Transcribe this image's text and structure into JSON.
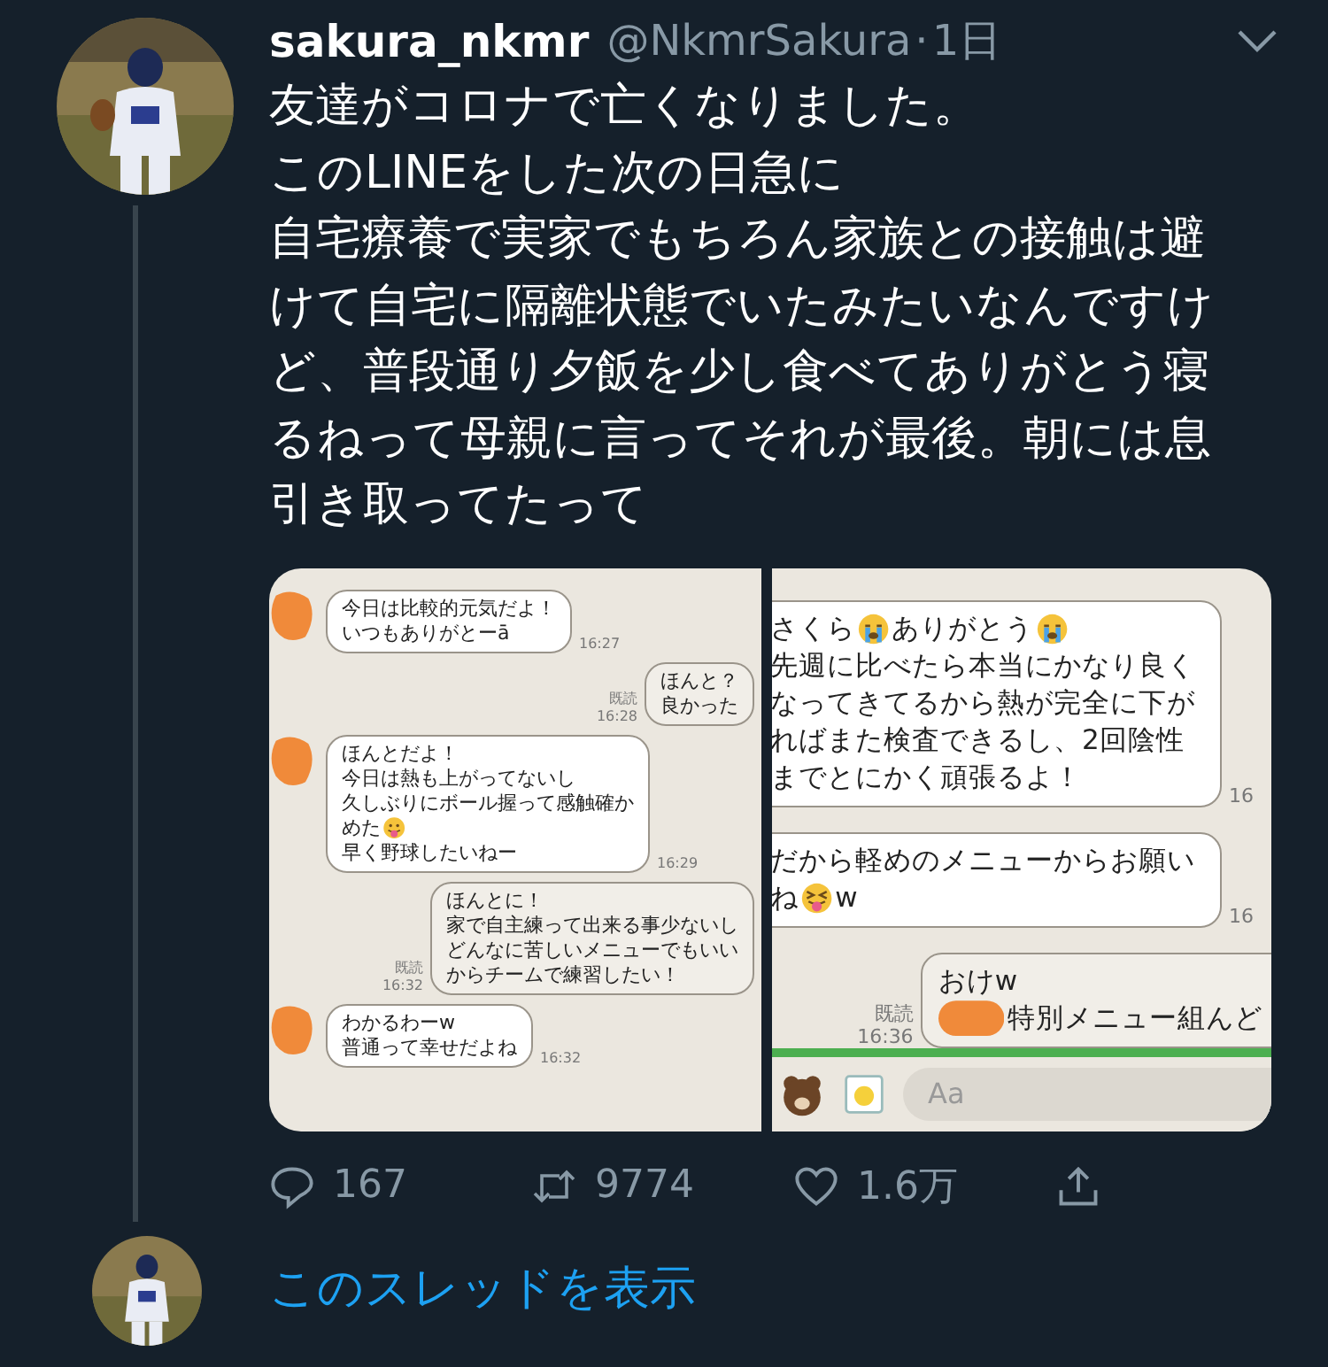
{
  "tweet": {
    "display_name": "sakura_nkmr",
    "handle": "@NkmrSakura",
    "separator": "·",
    "time": "1日",
    "paragraphs": [
      "友達がコロナで亡くなりました。",
      "このLINEをした次の日急に",
      "自宅療養で実家でもちろん家族との接触は避けて自宅に隔離状態でいたみたいなんですけど、普段通り夕飯を少し食べてありがとう寝るねって母親に言ってそれが最後。朝には息引き取ってたって"
    ]
  },
  "images": [
    {
      "messages": [
        {
          "kind": "received",
          "avatar_redacted": true,
          "lines": [
            "今日は比較的元気だよ！",
            "いつもありがとーā"
          ],
          "time": "16:27"
        },
        {
          "kind": "sent",
          "read": "既読",
          "lines": [
            "ほんと？",
            "良かった"
          ],
          "time": "16:28"
        },
        {
          "kind": "received",
          "avatar_redacted": true,
          "lines": [
            "ほんとだよ！",
            "今日は熱も上がってないし",
            "久しぶりにボール握って感触確か",
            [
              {
                "kind": "text",
                "text": "めた"
              },
              {
                "kind": "tongue-emoji"
              }
            ],
            "早く野球したいねー"
          ],
          "time": "16:29"
        },
        {
          "kind": "sent",
          "read": "既読",
          "lines": [
            "ほんとに！",
            "家で自主練って出来る事少ないし",
            "どんなに苦しいメニューでもいい",
            "からチームで練習したい！"
          ],
          "time": "16:32"
        },
        {
          "kind": "received",
          "avatar_redacted": true,
          "lines": [
            "わかるわーw",
            "普通って幸せだよね"
          ],
          "time": "16:32"
        }
      ]
    },
    {
      "messages": [
        {
          "kind": "received",
          "avatar_redacted": false,
          "lines": [
            [
              {
                "kind": "text",
                "text": "さくら"
              },
              {
                "kind": "cry-emoji"
              },
              {
                "kind": "text",
                "text": "ありがとう"
              },
              {
                "kind": "cry-emoji"
              }
            ],
            "先週に比べたら本当にかなり良く",
            "なってきてるから熱が完全に下が",
            "ればまた検査できるし、2回陰性",
            "までとにかく頑張るよ！"
          ],
          "time": "16"
        },
        {
          "kind": "received",
          "avatar_redacted": false,
          "lines": [
            "だから軽めのメニューからお願い",
            [
              {
                "kind": "text",
                "text": "ね"
              },
              {
                "kind": "squint-emoji"
              },
              {
                "kind": "text",
                "text": "w"
              }
            ]
          ],
          "time": "16"
        },
        {
          "kind": "sent",
          "read": "既読",
          "lines": [
            "おけw",
            [
              {
                "kind": "redaction"
              },
              {
                "kind": "text",
                "text": "特別メニュー組んど"
              }
            ]
          ],
          "time": "16:36"
        }
      ],
      "input_placeholder": "Aa"
    }
  ],
  "actions": [
    {
      "kind": "reply",
      "count": "167"
    },
    {
      "kind": "retweet",
      "count": "9774"
    },
    {
      "kind": "like",
      "count": "1.6万"
    },
    {
      "kind": "share"
    }
  ],
  "thread_link": "このスレッドを表示"
}
